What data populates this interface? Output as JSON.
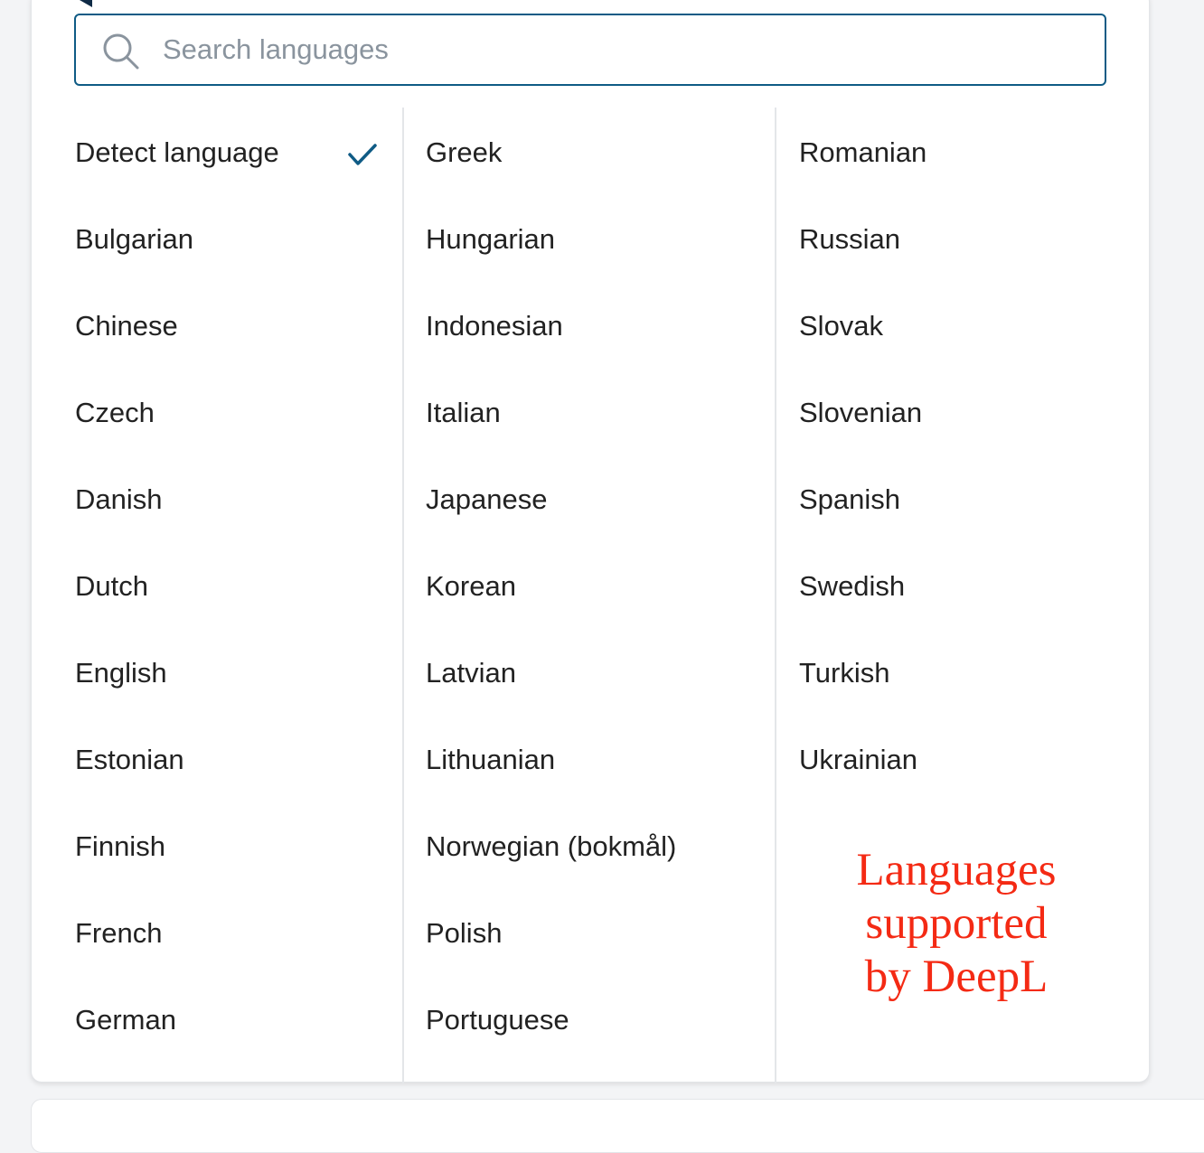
{
  "search": {
    "placeholder": "Search languages",
    "value": ""
  },
  "selected": "Detect language",
  "columns": [
    [
      "Detect language",
      "Bulgarian",
      "Chinese",
      "Czech",
      "Danish",
      "Dutch",
      "English",
      "Estonian",
      "Finnish",
      "French",
      "German"
    ],
    [
      "Greek",
      "Hungarian",
      "Indonesian",
      "Italian",
      "Japanese",
      "Korean",
      "Latvian",
      "Lithuanian",
      "Norwegian (bokmål)",
      "Polish",
      "Portuguese"
    ],
    [
      "Romanian",
      "Russian",
      "Slovak",
      "Slovenian",
      "Spanish",
      "Swedish",
      "Turkish",
      "Ukrainian"
    ]
  ],
  "annotation": "Languages\nsupported\nby DeepL",
  "colors": {
    "accent": "#0f5b85",
    "annotation": "#f42a14",
    "text": "#222222"
  },
  "icons": [
    "search-icon",
    "checkmark-icon"
  ]
}
